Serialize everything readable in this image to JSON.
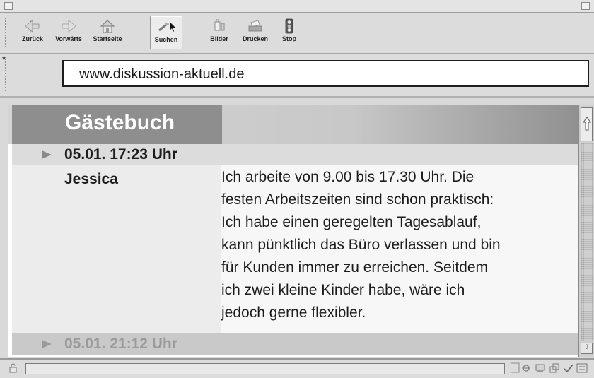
{
  "toolbar": {
    "buttons": [
      {
        "label": "Zurück",
        "icon": "back-arrow-icon"
      },
      {
        "label": "Vorwärts",
        "icon": "forward-arrow-icon"
      },
      {
        "label": "Startseite",
        "icon": "home-icon"
      },
      {
        "label": "Suchen",
        "icon": "search-icon"
      },
      {
        "label": "Bilder",
        "icon": "images-icon"
      },
      {
        "label": "Drucken",
        "icon": "print-icon"
      },
      {
        "label": "Stop",
        "icon": "stop-icon"
      }
    ]
  },
  "address": {
    "url": "www.diskussion-aktuell.de"
  },
  "page": {
    "title": "Gästebuch",
    "entries": [
      {
        "timestamp": "05.01.  17:23 Uhr",
        "author": "Jessica",
        "message_lines": [
          "Ich arbeite von 9.00 bis 17.30 Uhr. Die",
          "festen Arbeitszeiten sind schon praktisch:",
          "Ich habe einen geregelten Tagesablauf,",
          "kann pünktlich das Büro verlassen und bin",
          "für Kunden immer zu erreichen. Seitdem",
          "ich zwei kleine Kinder habe, wäre ich",
          "jedoch gerne flexibler."
        ]
      },
      {
        "timestamp": "05.01.  21:12 Uhr"
      }
    ]
  },
  "colors": {
    "header_box": "#8e8e8e",
    "date_row": "#dcdcdc",
    "message_bg": "#f7f7f7",
    "name_bg": "#ececec"
  }
}
